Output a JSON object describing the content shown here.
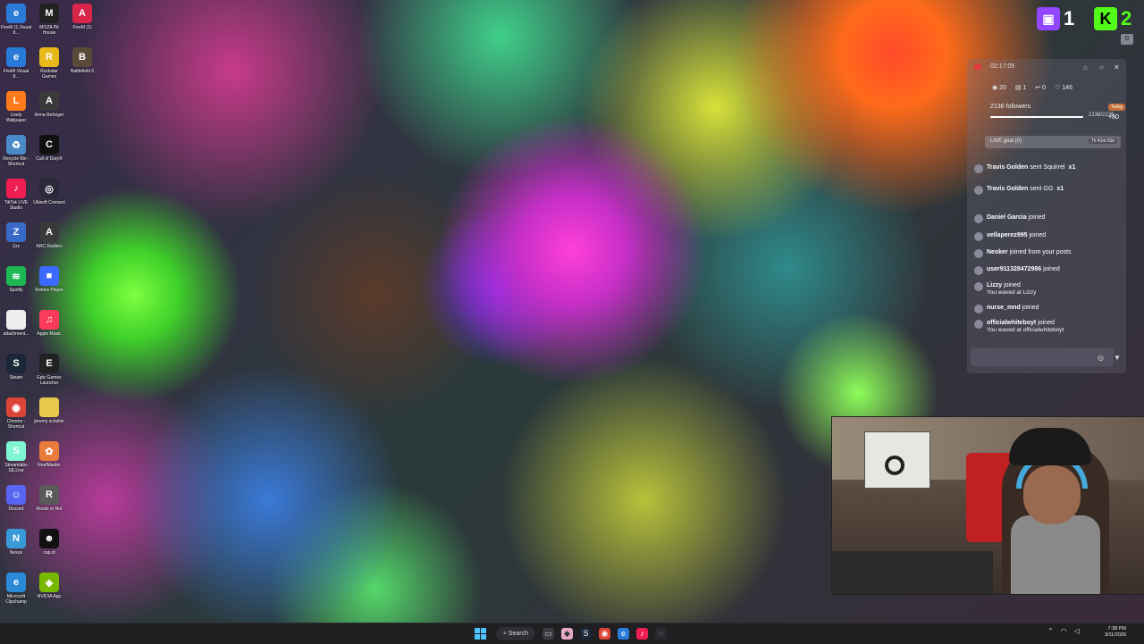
{
  "desktop": {
    "icons": [
      {
        "label": "FiveM (1.Visual 8...",
        "icon": "edge-icon",
        "color": "#2a7ad8",
        "glyph": "e"
      },
      {
        "label": "MOZA Pit House",
        "icon": "moza-icon",
        "color": "#222",
        "glyph": "M"
      },
      {
        "label": "FiveM (1)",
        "icon": "fivem-icon",
        "color": "#d8264a",
        "glyph": "A"
      },
      {
        "label": "FiveM.Visual 8...",
        "icon": "edge-icon",
        "color": "#2a7ad8",
        "glyph": "e"
      },
      {
        "label": "Rockstar Games",
        "icon": "rockstar-icon",
        "color": "#e8b81a",
        "glyph": "R"
      },
      {
        "label": "Battlefield 6",
        "icon": "battlefield-icon",
        "color": "#5a4a3a",
        "glyph": "B"
      },
      {
        "label": "Lively Wallpaper",
        "icon": "lively-icon",
        "color": "#ff7a1a",
        "glyph": "L"
      },
      {
        "label": "Arma Reforger",
        "icon": "arma-icon",
        "color": "#3a3a3a",
        "glyph": "A"
      },
      {
        "label": "Recycle Bin - Shortcut",
        "icon": "recycle-bin-icon",
        "color": "#4a8ac8",
        "glyph": "♻"
      },
      {
        "label": "Call of Duty®",
        "icon": "cod-icon",
        "color": "#111",
        "glyph": "C"
      },
      {
        "label": "TikTok LIVE Studio",
        "icon": "tiktok-icon",
        "color": "#ee1d52",
        "glyph": "♪"
      },
      {
        "label": "Ubisoft Connect",
        "icon": "ubisoft-icon",
        "color": "#2a2a3a",
        "glyph": "◎"
      },
      {
        "label": "Zzz",
        "icon": "zzz-icon",
        "color": "#3a6ac8",
        "glyph": "Z"
      },
      {
        "label": "ARC Raiders",
        "icon": "arc-raiders-icon",
        "color": "#3a3a3a",
        "glyph": "A"
      },
      {
        "label": "Spotify",
        "icon": "spotify-icon",
        "color": "#1db954",
        "glyph": "≋"
      },
      {
        "label": "Roblox Player",
        "icon": "roblox-icon",
        "color": "#3a6aff",
        "glyph": "■"
      },
      {
        "label": "attachment...",
        "icon": "file-icon",
        "color": "#eee",
        "glyph": ""
      },
      {
        "label": "Apple Music",
        "icon": "apple-music-icon",
        "color": "#fa3a5a",
        "glyph": "♫"
      },
      {
        "label": "Steam",
        "icon": "steam-icon",
        "color": "#1b2838",
        "glyph": "S"
      },
      {
        "label": "Epic Games Launcher",
        "icon": "epic-games-icon",
        "color": "#222",
        "glyph": "E"
      },
      {
        "label": "Chrome - Shortcut",
        "icon": "chrome-icon",
        "color": "#db4437",
        "glyph": "◉"
      },
      {
        "label": "jeremy scholtin",
        "icon": "folder-icon",
        "color": "#e8c84a",
        "glyph": ""
      },
      {
        "label": "Streamlabs SE.Live",
        "icon": "streamlabs-icon",
        "color": "#80f5d2",
        "glyph": "S"
      },
      {
        "label": "ReelMaster",
        "icon": "reel-icon",
        "color": "#e87a3a",
        "glyph": "✿"
      },
      {
        "label": "Discord",
        "icon": "discord-icon",
        "color": "#5865f2",
        "glyph": "☺"
      },
      {
        "label": "Rocks or Not",
        "icon": "game-icon",
        "color": "#5a5a5a",
        "glyph": "R"
      },
      {
        "label": "Nexus",
        "icon": "nexus-icon",
        "color": "#3a9ad8",
        "glyph": "N"
      },
      {
        "label": "cap.id",
        "icon": "capid-icon",
        "color": "#111",
        "glyph": "☻"
      },
      {
        "label": "Microsoft Clipchamp",
        "icon": "edge-icon",
        "color": "#2a8ad8",
        "glyph": "e"
      },
      {
        "label": "NVIDIA App",
        "icon": "nvidia-icon",
        "color": "#76b900",
        "glyph": "◈"
      }
    ]
  },
  "brand": {
    "twitch_count": "1",
    "kick_count": "2"
  },
  "overlay": {
    "header_time": "02:17:05",
    "stats": {
      "viewers": "20",
      "chats": "1",
      "shares": "0",
      "likes": "146"
    },
    "followers_label": "2136 followers",
    "followers_progress": "2138/2136",
    "today_badge": "Today",
    "today_count": "+80",
    "goal_label": "LIVE goal (0)",
    "goal_time": "7h 41m 59s",
    "feed": [
      {
        "name": "Travis Golden",
        "text": "sent Squirrel",
        "suffix": "x1"
      },
      {
        "name": "Travis Golden",
        "text": "sent GG",
        "suffix": "x1"
      },
      {
        "name": "Daniel Garcia",
        "text": "joined",
        "sub": ""
      },
      {
        "name": "vellaperez995",
        "text": "joined",
        "sub": ""
      },
      {
        "name": "Neoker",
        "text": "joined from your posts",
        "sub": ""
      },
      {
        "name": "user911328472986",
        "text": "joined",
        "sub": ""
      },
      {
        "name": "Lizzy",
        "text": "joined",
        "sub": "You waved at Lizzy"
      },
      {
        "name": "nurse_mnd",
        "text": "joined",
        "sub": ""
      },
      {
        "name": "officialwhiteboyt",
        "text": "joined",
        "sub": "You waved at officialwhiteboyt"
      }
    ]
  },
  "taskbar": {
    "search_label": "Search",
    "time": "7:38 PM",
    "date": "3/11/2026"
  }
}
